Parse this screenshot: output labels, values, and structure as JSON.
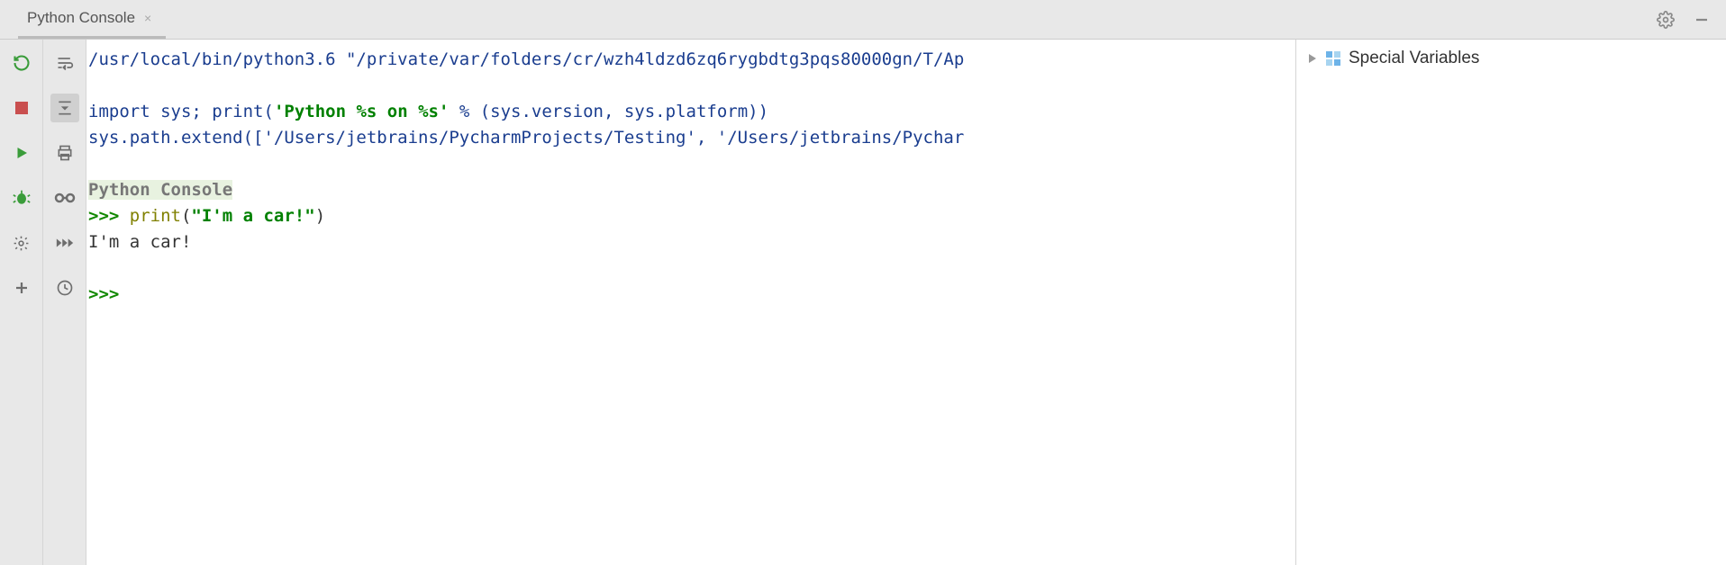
{
  "tab": {
    "title": "Python Console",
    "close_glyph": "×"
  },
  "console": {
    "line1": "/usr/local/bin/python3.6 \"/private/var/folders/cr/wzh4ldzd6zq6rygbdtg3pqs80000gn/T/Ap",
    "line2": "",
    "line3_pre": "import sys; ",
    "line3_print": "print",
    "line3_open": "(",
    "line3_str": "'Python %s on %s'",
    "line3_mid": " % (sys.version, sys.platform))",
    "line4": "sys.path.extend(['/Users/jetbrains/PycharmProjects/Testing', '/Users/jetbrains/Pychar",
    "line5": "",
    "heading": "Python Console",
    "prompt1": ">>> ",
    "call_print": "print",
    "call_open": "(",
    "call_str": "\"I'm a car!\"",
    "call_close": ")",
    "output": "I'm a car!",
    "empty": "",
    "prompt2": ">>> "
  },
  "vars": {
    "title": "Special Variables"
  }
}
